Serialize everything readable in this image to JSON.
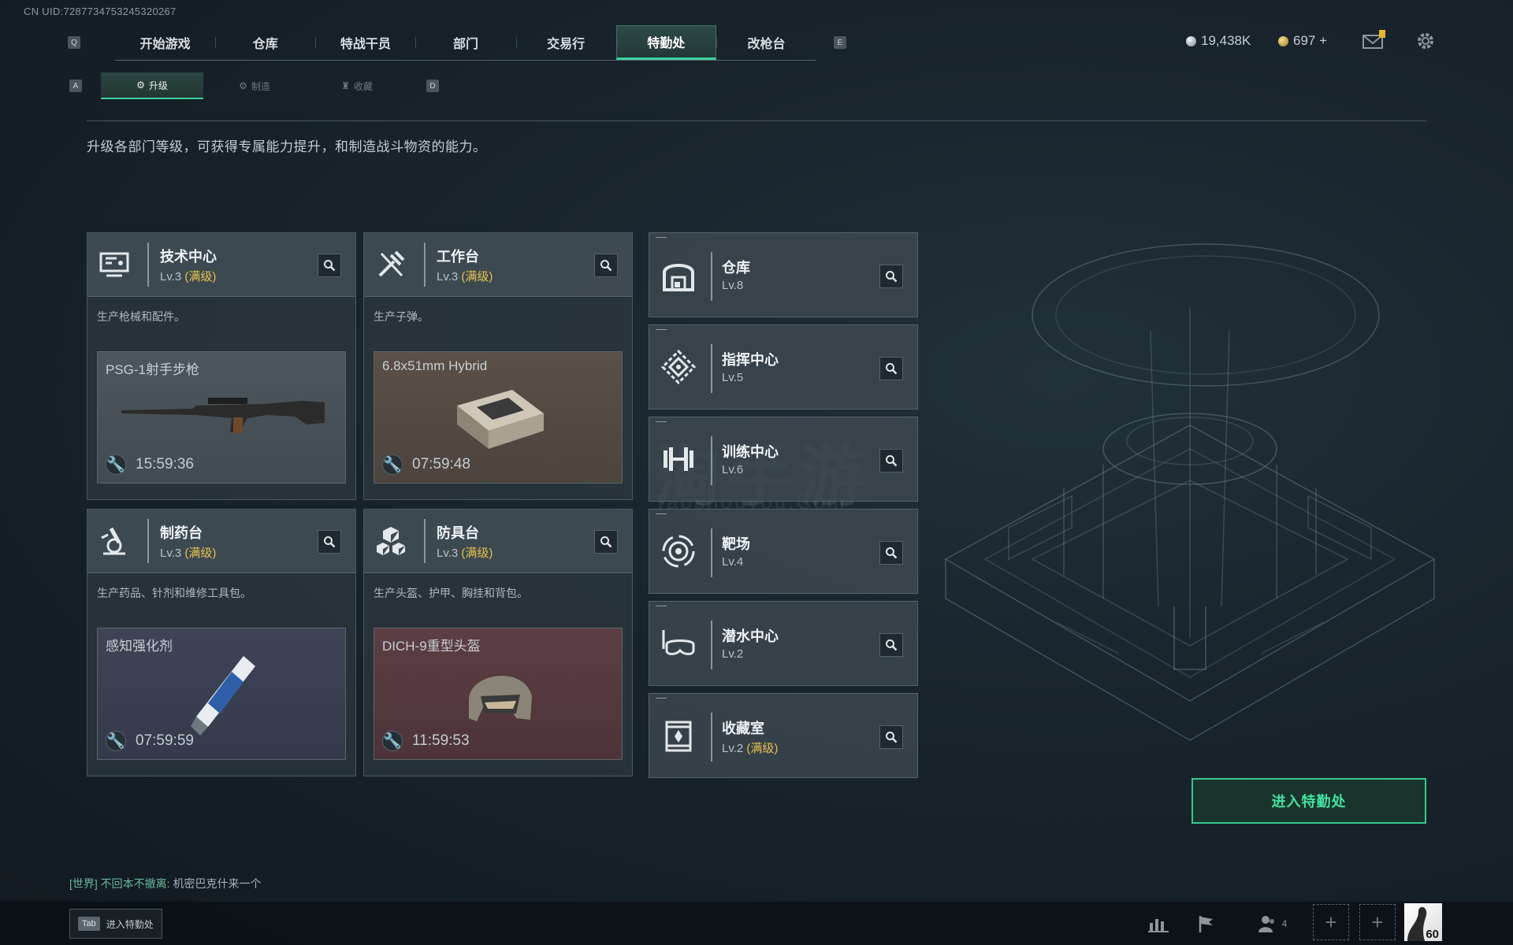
{
  "uid": "CN UID:7287734753245320267",
  "nav": {
    "key_left": "Q",
    "key_right": "E",
    "tabs": [
      "开始游戏",
      "仓库",
      "特战干员",
      "部门",
      "交易行",
      "特勤处",
      "改枪台"
    ],
    "active": "特勤处"
  },
  "currency": {
    "silver": "19,438K",
    "gold": "697 +"
  },
  "subnav": {
    "key_left": "A",
    "key_right": "D",
    "tabs": [
      "升级",
      "制造",
      "收藏"
    ],
    "active": "升级"
  },
  "description": "升级各部门等级，可获得专属能力提升，和制造战斗物资的能力。",
  "stations": [
    {
      "name": "技术中心",
      "level": "Lv.3",
      "max": "(满级)",
      "desc": "生产枪械和配件。",
      "product": "PSG-1射手步枪",
      "timer": "15:59:36",
      "icon": "monitor-icon"
    },
    {
      "name": "工作台",
      "level": "Lv.3",
      "max": "(满级)",
      "desc": "生产子弹。",
      "product": "6.8x51mm Hybrid",
      "timer": "07:59:48",
      "icon": "tools-icon"
    },
    {
      "name": "制药台",
      "level": "Lv.3",
      "max": "(满级)",
      "desc": "生产药品、针剂和维修工具包。",
      "product": "感知强化剂",
      "timer": "07:59:59",
      "icon": "microscope-icon"
    },
    {
      "name": "防具台",
      "level": "Lv.3",
      "max": "(满级)",
      "desc": "生产头盔、护甲、胸挂和背包。",
      "product": "DICH-9重型头盔",
      "timer": "11:59:53",
      "icon": "cubes-icon"
    }
  ],
  "facilities": [
    {
      "name": "仓库",
      "level": "Lv.8",
      "max": "",
      "icon": "warehouse-icon"
    },
    {
      "name": "指挥中心",
      "level": "Lv.5",
      "max": "",
      "icon": "command-icon"
    },
    {
      "name": "训练中心",
      "level": "Lv.6",
      "max": "",
      "icon": "dumbbell-icon"
    },
    {
      "name": "靶场",
      "level": "Lv.4",
      "max": "",
      "icon": "target-icon"
    },
    {
      "name": "潜水中心",
      "level": "Lv.2",
      "max": "",
      "icon": "diving-mask-icon"
    },
    {
      "name": "收藏室",
      "level": "Lv.2",
      "max": "(满级)",
      "icon": "collection-icon"
    }
  ],
  "enter_button": "进入特勤处",
  "chat": {
    "channel": "[世界]",
    "user": "不回本不撤离:",
    "message": "机密巴克什来一个"
  },
  "bottom": {
    "tab_key": "Tab",
    "tab_label": "进入特勤处",
    "squad_count": "4",
    "level": "60"
  },
  "watermark": {
    "cn": "淘手游",
    "en": "Taoshouyou.Com"
  },
  "colors": {
    "accent": "#3ed39b",
    "max_level": "#e8c24c"
  }
}
